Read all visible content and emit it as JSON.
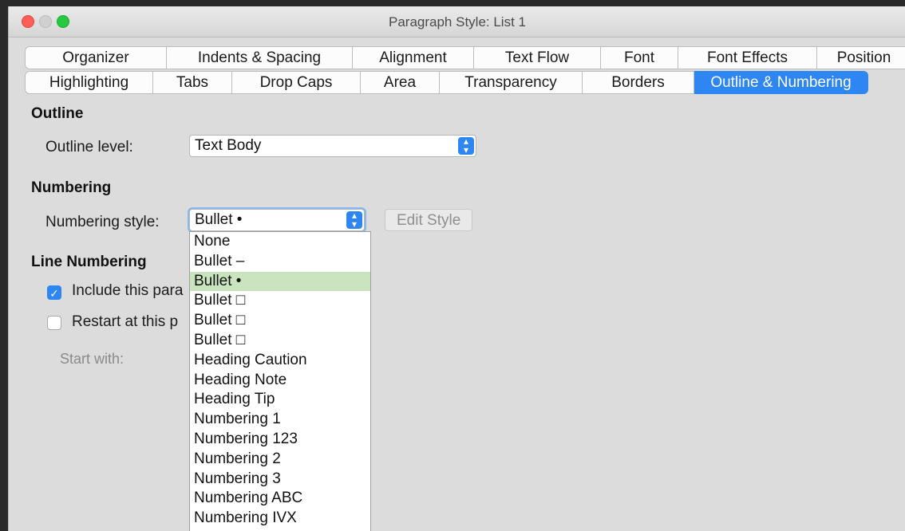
{
  "window": {
    "title": "Paragraph Style: List 1"
  },
  "tabs_row1": [
    "Organizer",
    "Indents & Spacing",
    "Alignment",
    "Text Flow",
    "Font",
    "Font Effects",
    "Position"
  ],
  "tabs_row2": [
    "Highlighting",
    "Tabs",
    "Drop Caps",
    "Area",
    "Transparency",
    "Borders",
    "Outline & Numbering"
  ],
  "active_tab": "Outline & Numbering",
  "outline": {
    "heading": "Outline",
    "level_label": "Outline level:",
    "level_value": "Text Body"
  },
  "numbering": {
    "heading": "Numbering",
    "style_label": "Numbering style:",
    "style_value": "Bullet •",
    "edit_button": "Edit Style"
  },
  "line_numbering": {
    "heading": "Line Numbering",
    "include_label": "Include this para",
    "include_checked": true,
    "restart_label": "Restart at this p",
    "restart_checked": false,
    "start_with_label": "Start with:"
  },
  "dropdown": {
    "selected": "Bullet •",
    "options": [
      "None",
      "Bullet –",
      "Bullet •",
      "Bullet □",
      "Bullet □",
      "Bullet □",
      "Heading Caution",
      "Heading Note",
      "Heading Tip",
      "Numbering 1",
      "Numbering 123",
      "Numbering 2",
      "Numbering 3",
      "Numbering ABC",
      "Numbering IVX"
    ]
  },
  "colors": {
    "accent": "#2d86f2",
    "selection": "#c9e4bf"
  }
}
